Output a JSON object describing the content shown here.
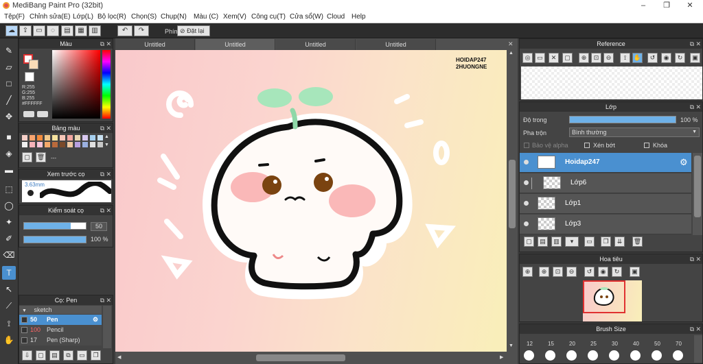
{
  "app": {
    "title": "MediBang Paint Pro (32bit)",
    "min": "–",
    "max": "❐",
    "close": "✕"
  },
  "menu": [
    "Tệp(F)",
    "Chỉnh sửa(E)",
    "Lớp(L)",
    "Bộ lọc(R)",
    "Chọn(S)",
    "Chụp(N)",
    "Màu (C)",
    "Xem(V)",
    "Công cụ(T)",
    "Cửa sổ(W)",
    "Cloud",
    "Help"
  ],
  "toolbar": {
    "phim_label": "Phím",
    "reset_label": "Đặt lại"
  },
  "color_panel": {
    "title": "Màu",
    "r": "R:255",
    "g": "G:255",
    "b": "B:255",
    "hex": "#FFFFFF"
  },
  "palette_panel": {
    "title": "Bảng màu",
    "ellipsis": "---",
    "swatches": [
      "#f6d0c8",
      "#f9a46f",
      "#f28b3c",
      "#f2c88a",
      "#f6e29e",
      "#f7c6b7",
      "#f2a6a0",
      "#e8d6b2",
      "#d8c8f0",
      "#a6d0f0",
      "#c8e0f0",
      "#f0f0f0",
      "#f6b2b8",
      "#f7c4d9",
      "#f4a96a",
      "#b86a3c",
      "#7a4a2a",
      "#f0c8a0",
      "#b8a0e0",
      "#9ab0e0",
      "#e0e0e0",
      "#c8c8c8"
    ]
  },
  "preview_panel": {
    "title": "Xem trước cọ",
    "size": "3.63mm"
  },
  "brush_control": {
    "title": "Kiểm soát cọ",
    "size": "50",
    "opacity": "100 %",
    "size_fill": 0.76,
    "opacity_fill": 1.0
  },
  "brush_panel": {
    "title": "Cọ: Pen",
    "group": "sketch",
    "items": [
      {
        "size": "50",
        "name": "Pen",
        "color": "#ffffff"
      },
      {
        "size": "100",
        "name": "Pencil",
        "color": "#ff6666"
      },
      {
        "size": "17",
        "name": "Pen (Sharp)",
        "color": "#ffffff"
      }
    ]
  },
  "tabs": [
    "Untitled",
    "Untitled",
    "Untitled",
    "Untitled"
  ],
  "canvas": {
    "watermark_line1": "HOIDAP247",
    "watermark_line2": "2HUONGNE"
  },
  "reference_panel": {
    "title": "Reference"
  },
  "layer_panel": {
    "title": "Lớp",
    "opacity_label": "Độ trong",
    "opacity_value": "100 %",
    "opacity_fill": 1.0,
    "blend_label": "Pha trộn",
    "blend_value": "Bình thường",
    "protect_alpha": "Bảo vệ alpha",
    "clip": "Xén bớt",
    "lock": "Khóa",
    "layers": [
      "Hoidap247",
      "Lớp6",
      "Lớp1",
      "Lớp3"
    ]
  },
  "navigator_panel": {
    "title": "Hoa tiêu"
  },
  "brush_size_panel": {
    "title": "Brush Size",
    "sizes": [
      "12",
      "15",
      "20",
      "25",
      "30",
      "40",
      "50",
      "70"
    ]
  }
}
